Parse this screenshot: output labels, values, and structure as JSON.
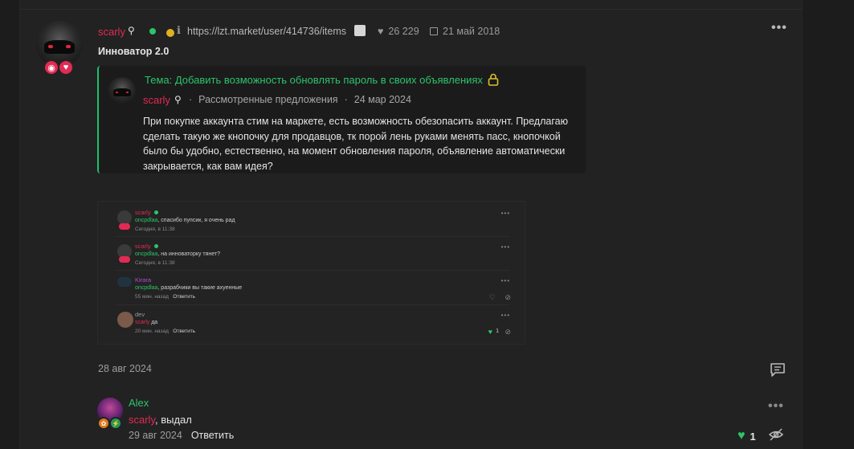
{
  "post": {
    "author": "scarly",
    "profile_link": "https://lzt.market/user/414736/items",
    "likes": "26 229",
    "register_date": "21 май 2018",
    "user_title": "Инноватор 2.0"
  },
  "quote": {
    "title": "Тема: Добавить возможность обновлять пароль в своих объявлениях",
    "author": "scarly",
    "separator": "·",
    "section": "Рассмотренные предложения",
    "date": "24 мар 2024",
    "body": "При покупке аккаунта стим на маркете, есть возможность обезопасить аккаунт. Предлагаю сделать такую же кнопочку для продавцов, тк порой лень руками менять пасс, кнопочкой было бы удобно, естественно, на момент обновления пароля, объявление автоматически закрывается, как вам идея?"
  },
  "embed": {
    "rows": [
      {
        "name": "scarly",
        "mention": "oncpdlaa",
        "text": ", спасибо пупсик, я очень рад",
        "meta": "Сегодня, в 11:38"
      },
      {
        "name": "scarly",
        "mention": "oncpdlaa",
        "text": ", на инноваторку тянет?",
        "meta": "Сегодня, в 11:38"
      },
      {
        "name": "Kirara",
        "mention": "oncpdlaa",
        "text": ", разрабчики вы такие ахуенные",
        "meta": "55 мин. назад",
        "reply": "Ответить"
      },
      {
        "name": "dev",
        "mention": "scarly",
        "text": " да",
        "meta": "20 мин. назад",
        "reply": "Ответить",
        "likes": "1"
      }
    ],
    "dots": "•••"
  },
  "date_separator": "28 авг 2024",
  "reply": {
    "author": "Alex",
    "mention": "scarly",
    "text": ", выдал",
    "date": "29 авг 2024",
    "reply_label": "Ответить",
    "likes": "1"
  },
  "menu_dots": "•••",
  "colors": {
    "accent_green": "#2cc46b",
    "username_red": "#e22b53",
    "background": "#222222"
  }
}
